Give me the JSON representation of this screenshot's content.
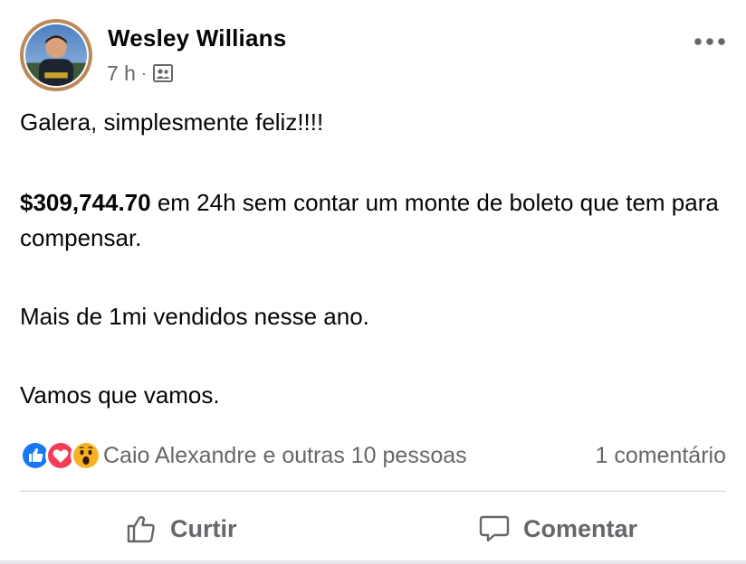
{
  "post": {
    "author": "Wesley Willians",
    "time": "7 h",
    "separator": "·",
    "audience_icon": "friends-photo-icon",
    "more_icon": "more-dots-icon"
  },
  "content": {
    "line1": "Galera, simplesmente feliz!!!!",
    "amount": "$309,744.70",
    "line2_rest": " em 24h sem contar um monte de boleto que tem para compensar.",
    "line3": "Mais de 1mi vendidos nesse ano.",
    "line4": "Vamos que vamos."
  },
  "reactions": {
    "icons": [
      "like-reaction-icon",
      "love-reaction-icon",
      "wow-reaction-icon"
    ],
    "text": "Caio Alexandre e outras 10 pessoas",
    "comments": "1 comentário"
  },
  "actions": {
    "like_label": "Curtir",
    "comment_label": "Comentar"
  },
  "colors": {
    "text": "#050505",
    "secondary": "#65676b",
    "like_blue": "#1877f2",
    "love_red": "#f33e58",
    "wow_yellow": "#f7b125",
    "avatar_ring": "#b98a58"
  }
}
